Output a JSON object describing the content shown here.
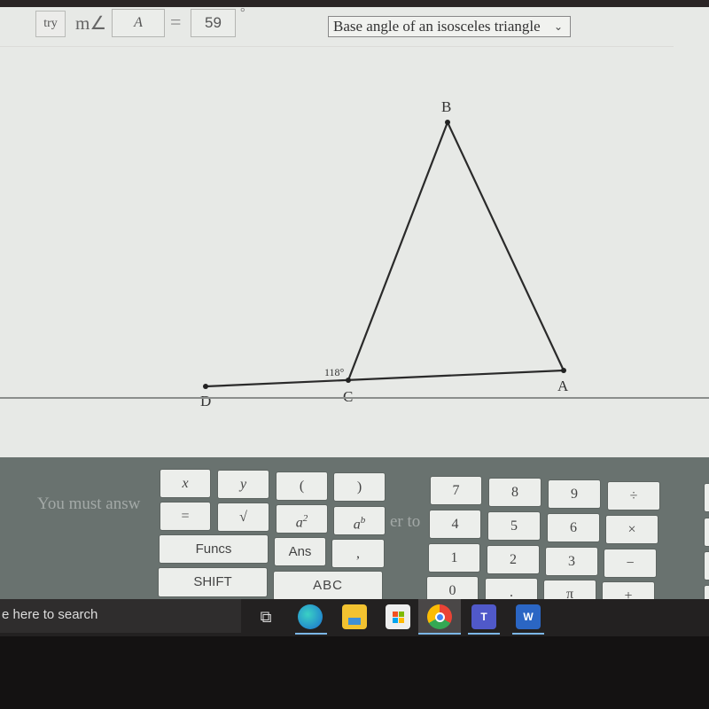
{
  "answer_row": {
    "try_label": "try",
    "measure_prefix": "m∠",
    "angle_name": "A",
    "equals": "=",
    "value": "59",
    "degree_symbol": "°",
    "reason_select": "Base angle of an isosceles triangle"
  },
  "diagram": {
    "points": [
      {
        "name": "B",
        "label": "B"
      },
      {
        "name": "A",
        "label": "A"
      },
      {
        "name": "C",
        "label": "C"
      },
      {
        "name": "D",
        "label": "D"
      }
    ],
    "exterior_angle_label": "118°"
  },
  "hint_text": {
    "left": "You must answ",
    "right": "er to"
  },
  "keypad": {
    "row1": [
      "x",
      "y",
      "(",
      ")"
    ],
    "row2": [
      "=",
      "√",
      "a",
      "a"
    ],
    "row2_exponents": [
      "2",
      "b"
    ],
    "row3": [
      "Funcs",
      "Ans",
      ","
    ],
    "row4": [
      "SHIFT",
      "ABC"
    ],
    "numpad": [
      [
        "7",
        "8",
        "9",
        "÷"
      ],
      [
        "4",
        "5",
        "6",
        "×"
      ],
      [
        "1",
        "2",
        "3",
        "−"
      ],
      [
        "0",
        ".",
        "π",
        "+"
      ]
    ]
  },
  "taskbar": {
    "search_placeholder": "e here to search",
    "apps": [
      "task-view",
      "edge",
      "file-explorer",
      "microsoft-store",
      "chrome",
      "teams",
      "word"
    ],
    "word_letter": "W",
    "teams_letter": "T"
  }
}
